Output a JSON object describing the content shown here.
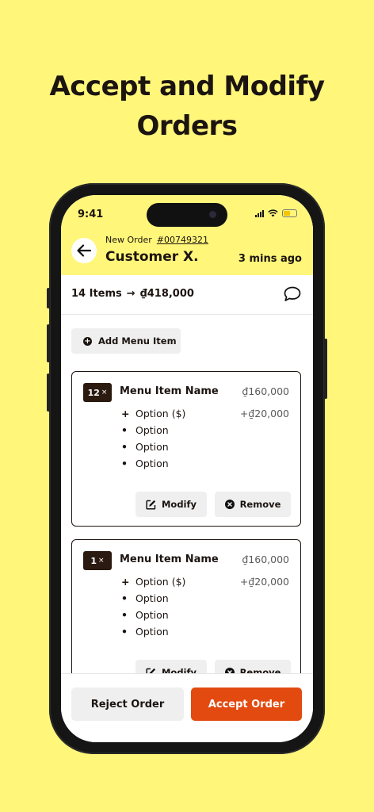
{
  "headline": {
    "line1": "Accept and Modify",
    "line2": "Orders"
  },
  "status_bar": {
    "time": "9:41"
  },
  "order": {
    "label": "New Order",
    "number": "#00749321",
    "customer": "Customer X.",
    "time_ago": "3 mins ago"
  },
  "summary": {
    "items": "14 Items",
    "arrow": "→",
    "total": "₫418,000",
    "chat_icon": "chat-bubble-icon"
  },
  "add_menu_item_label": "Add Menu Item",
  "cards": [
    {
      "qty": "12",
      "qty_suffix": "×",
      "name": "Menu Item Name",
      "price": "₫160,000",
      "options": [
        {
          "mark": "+",
          "label": "Option ($)",
          "price": "+₫20,000"
        },
        {
          "mark": "•",
          "label": "Option"
        },
        {
          "mark": "•",
          "label": "Option"
        },
        {
          "mark": "•",
          "label": "Option"
        }
      ],
      "modify_label": "Modify",
      "remove_label": "Remove"
    },
    {
      "qty": "1",
      "qty_suffix": "×",
      "name": "Menu Item Name",
      "price": "₫160,000",
      "options": [
        {
          "mark": "+",
          "label": "Option ($)",
          "price": "+₫20,000"
        },
        {
          "mark": "•",
          "label": "Option"
        },
        {
          "mark": "•",
          "label": "Option"
        },
        {
          "mark": "•",
          "label": "Option"
        }
      ],
      "modify_label": "Modify",
      "remove_label": "Remove"
    }
  ],
  "footer": {
    "reject_label": "Reject Order",
    "accept_label": "Accept Order"
  },
  "colors": {
    "background": "#fff67a",
    "accent": "#e24a10",
    "dark": "#1c1410"
  }
}
